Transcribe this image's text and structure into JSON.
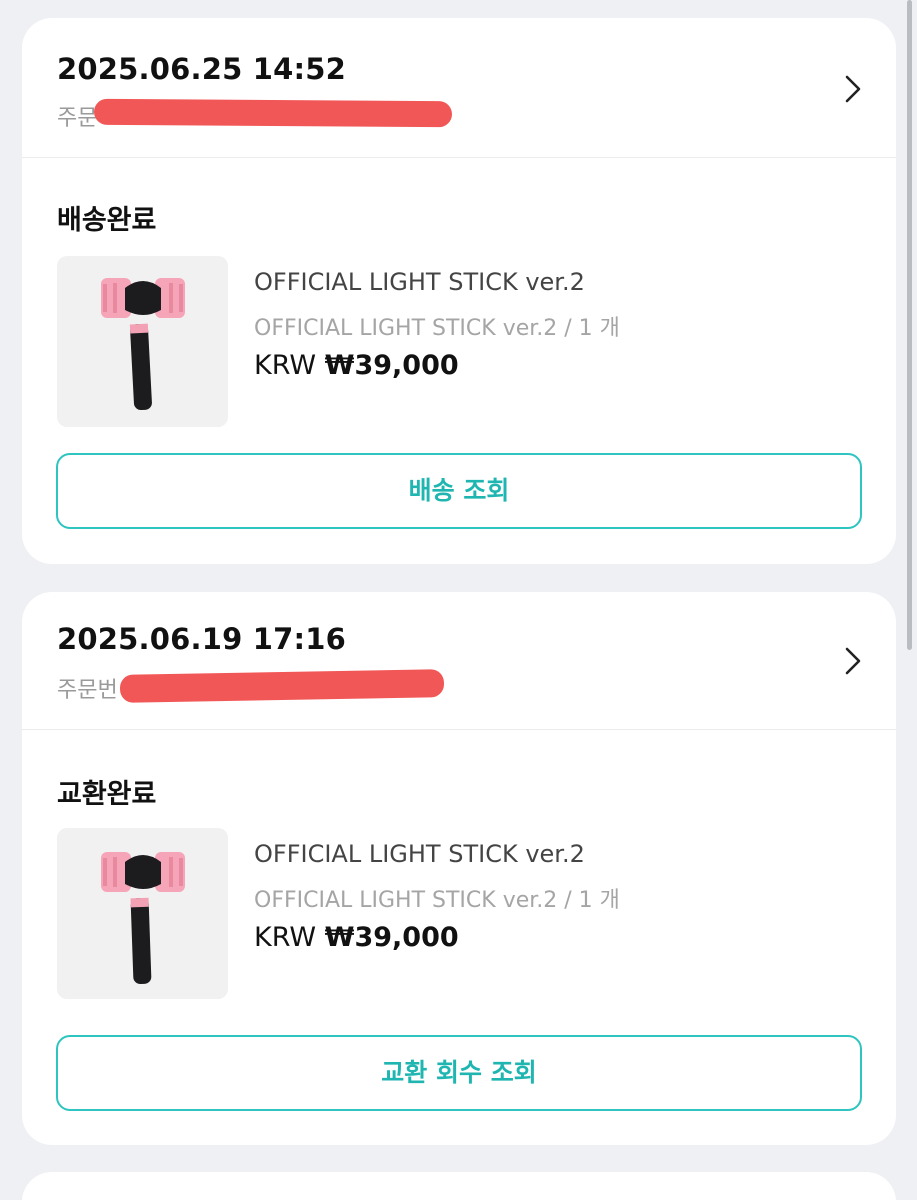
{
  "orders": [
    {
      "date": "2025.06.25 14:52",
      "order_number_prefix": "주문",
      "status": "배송완료",
      "product": {
        "name": "OFFICIAL LIGHT STICK ver.2",
        "option": "OFFICIAL LIGHT STICK ver.2 / 1 개",
        "currency": "KRW",
        "price": "₩39,000"
      },
      "action_label": "배송 조회"
    },
    {
      "date": "2025.06.19 17:16",
      "order_number_prefix": "주문번",
      "status": "교환완료",
      "product": {
        "name": "OFFICIAL LIGHT STICK ver.2",
        "option": "OFFICIAL LIGHT STICK ver.2 / 1 개",
        "currency": "KRW",
        "price": "₩39,000"
      },
      "action_label": "교환 회수 조회"
    }
  ],
  "icons": {
    "chevron": "chevron-right-icon",
    "product_image": "light-stick-image"
  },
  "colors": {
    "accent": "#1fb5b1",
    "accent_border": "#2ec4c0",
    "redaction": "#f25757",
    "background": "#eef0f3"
  }
}
